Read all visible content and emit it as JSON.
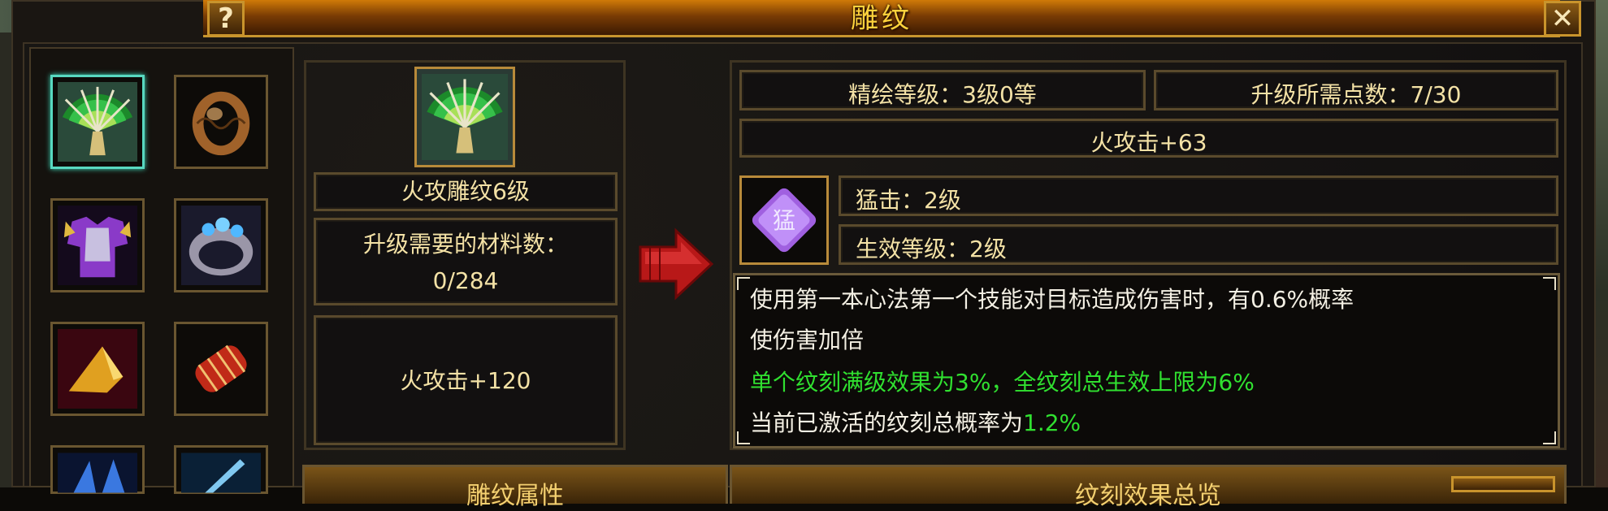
{
  "window": {
    "title": "雕纹",
    "help_label": "?",
    "close_label": "✕"
  },
  "slots": [
    {
      "item": "fan-weapon-icon",
      "selected": true
    },
    {
      "item": "bronze-ring-icon",
      "selected": false
    },
    {
      "item": "purple-armor-icon",
      "selected": false
    },
    {
      "item": "jeweled-ring-icon",
      "selected": false
    },
    {
      "item": "gold-shoulder-icon",
      "selected": false
    },
    {
      "item": "red-bracer-icon",
      "selected": false
    },
    {
      "item": "blue-wing-icon",
      "selected": false
    },
    {
      "item": "blue-blade-icon",
      "selected": false
    }
  ],
  "carving": {
    "name": "火攻雕纹6级",
    "material_label": "升级需要的材料数：",
    "material_value": "0/284",
    "attribute": "火攻击+120"
  },
  "refine": {
    "level_text": "精绘等级：3级0等",
    "points_text": "升级所需点数：7/30",
    "attribute": "火攻击+63",
    "skill_name": "猛击：2级",
    "skill_effect_level": "生效等级：2级",
    "skill_icon_glyph": "猛"
  },
  "description": {
    "line1": "使用第一本心法第一个技能对目标造成伤害时，有0.6%概率",
    "line2": "使伤害加倍",
    "line3": "单个纹刻满级效果为3%，全纹刻总生效上限为6%",
    "line4_prefix": "当前已激活的纹刻总概率为",
    "line4_value": "1.2%"
  },
  "tabs": {
    "left": "雕纹属性",
    "right": "纹刻效果总览"
  },
  "colors": {
    "text": "#f4e2a6",
    "highlight_green": "#30e030",
    "title_gold": "#ffd23c",
    "selected_border": "#58d8c0"
  }
}
